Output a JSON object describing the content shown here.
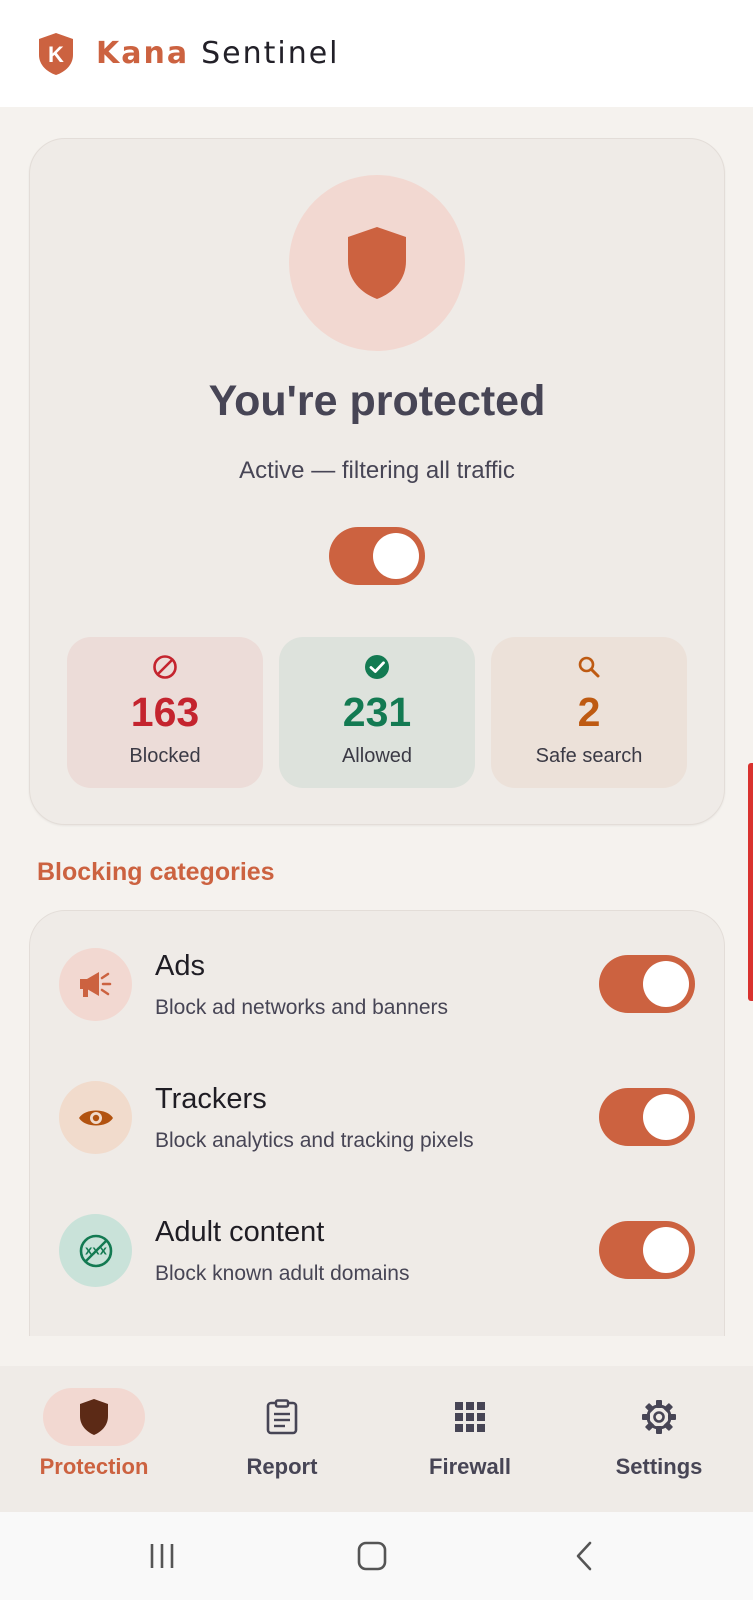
{
  "app": {
    "brand_part1": "Kana",
    "brand_part2": "Sentinel",
    "logo_letter": "K",
    "accent_color": "#cc6240"
  },
  "status": {
    "title": "You're protected",
    "subtitle": "Active — filtering all traffic",
    "protection_enabled": true
  },
  "stats": [
    {
      "icon": "blocked-icon",
      "value": "163",
      "label": "Blocked",
      "color": "#c4242e"
    },
    {
      "icon": "check-circle-icon",
      "value": "231",
      "label": "Allowed",
      "color": "#137a52"
    },
    {
      "icon": "search-icon",
      "value": "2",
      "label": "Safe search",
      "color": "#be5a12"
    }
  ],
  "categories_section": {
    "header": "Blocking categories",
    "items": [
      {
        "icon": "megaphone-icon",
        "title": "Ads",
        "description": "Block ad networks and banners",
        "enabled": true
      },
      {
        "icon": "eye-icon",
        "title": "Trackers",
        "description": "Block analytics and tracking pixels",
        "enabled": true
      },
      {
        "icon": "adult-content-icon",
        "icon_text": "XXX",
        "title": "Adult content",
        "description": "Block known adult domains",
        "enabled": true
      }
    ]
  },
  "bottom_nav": {
    "active": "Protection",
    "items": [
      {
        "icon": "shield-icon",
        "label": "Protection"
      },
      {
        "icon": "clipboard-icon",
        "label": "Report"
      },
      {
        "icon": "grid-icon",
        "label": "Firewall"
      },
      {
        "icon": "gear-icon",
        "label": "Settings"
      }
    ]
  }
}
